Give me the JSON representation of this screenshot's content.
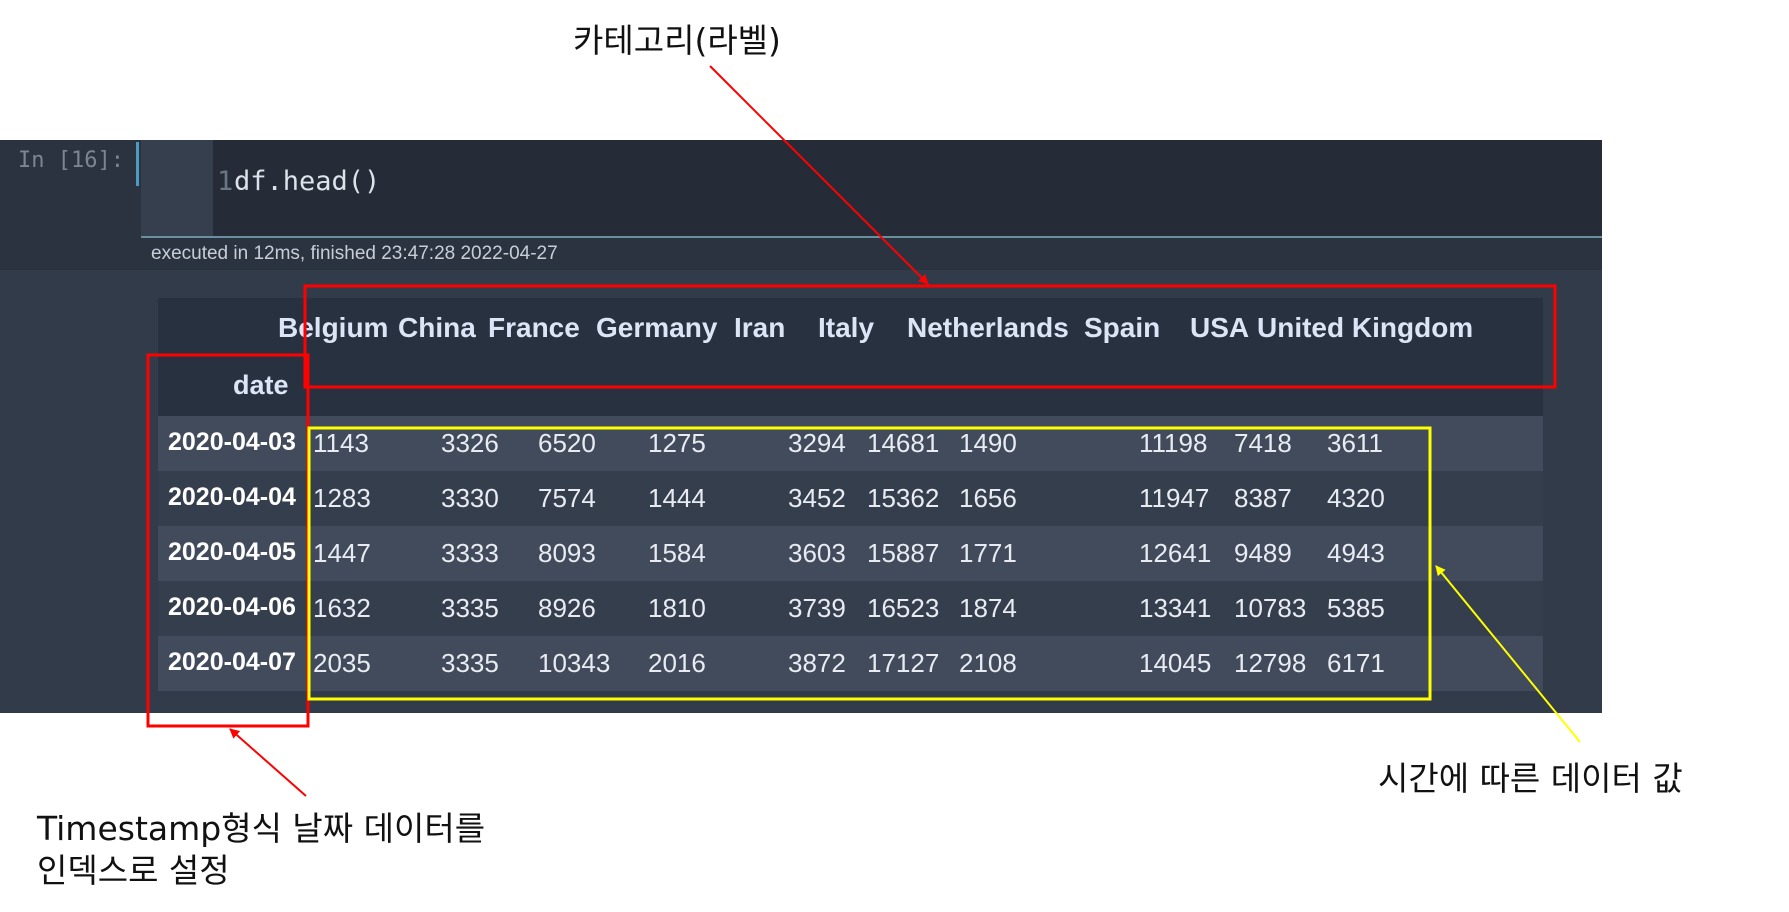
{
  "annotations": {
    "top": "카테고리(라벨)",
    "right": "시간에 따른 데이터 값",
    "left_line1": "Timestamp형식 날짜 데이터를",
    "left_line2": "인덱스로 설정",
    "colors": {
      "red": "#ff0000",
      "yellow": "#ffff00"
    }
  },
  "cell": {
    "prompt": "In [16]:",
    "line_number": "1",
    "code": "df.head()",
    "exec_info": "executed in 12ms, finished 23:47:28 2022-04-27"
  },
  "dataframe": {
    "index_name": "date",
    "columns": [
      "Belgium",
      "China",
      "France",
      "Germany",
      "Iran",
      "Italy",
      "Netherlands",
      "Spain",
      "USA",
      "United Kingdom"
    ],
    "rows": [
      {
        "date": "2020-04-03",
        "values": [
          "1143",
          "3326",
          "6520",
          "1275",
          "3294",
          "14681",
          "1490",
          "11198",
          "7418",
          "3611"
        ]
      },
      {
        "date": "2020-04-04",
        "values": [
          "1283",
          "3330",
          "7574",
          "1444",
          "3452",
          "15362",
          "1656",
          "11947",
          "8387",
          "4320"
        ]
      },
      {
        "date": "2020-04-05",
        "values": [
          "1447",
          "3333",
          "8093",
          "1584",
          "3603",
          "15887",
          "1771",
          "12641",
          "9489",
          "4943"
        ]
      },
      {
        "date": "2020-04-06",
        "values": [
          "1632",
          "3335",
          "8926",
          "1810",
          "3739",
          "16523",
          "1874",
          "13341",
          "10783",
          "5385"
        ]
      },
      {
        "date": "2020-04-07",
        "values": [
          "2035",
          "3335",
          "10343",
          "2016",
          "3872",
          "17127",
          "2108",
          "14045",
          "12798",
          "6171"
        ]
      }
    ]
  }
}
